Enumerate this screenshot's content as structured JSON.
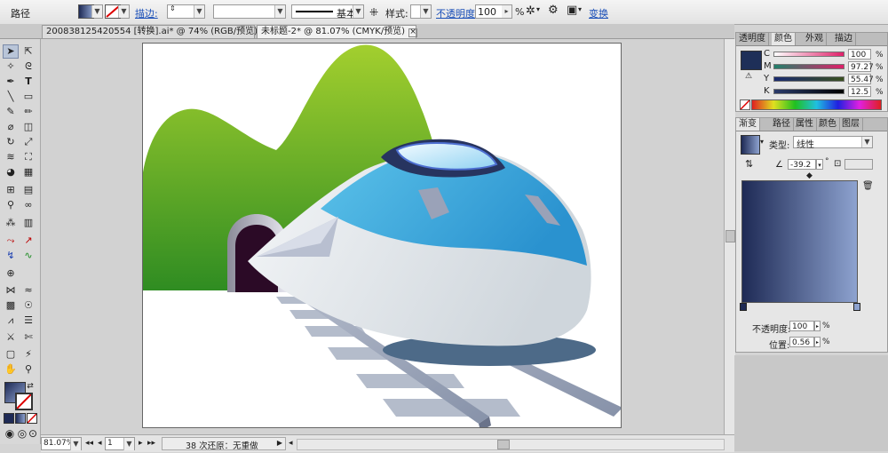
{
  "control_bar": {
    "object_type": "路径",
    "stroke_link": "描边:",
    "stroke_weight": "",
    "brush_value": "",
    "stroke_profile": "基本",
    "style_label": "样式:",
    "opacity_link": "不透明度:",
    "opacity_value": "100",
    "opacity_unit": "%",
    "transform_link": "变换"
  },
  "tabs": [
    {
      "label": "200838125420554  [转换].ai* @ 74% (RGB/预览)",
      "active": false
    },
    {
      "label": "未标题-2* @ 81.07% (CMYK/预览)",
      "active": true
    }
  ],
  "color_panel": {
    "tabs": [
      "透明度",
      "颜色",
      "外观",
      "描边"
    ],
    "active_tab": "颜色",
    "channels": [
      {
        "name": "C",
        "value": "100",
        "color": "#e0206a"
      },
      {
        "name": "M",
        "value": "97.27",
        "color": "#2aa070"
      },
      {
        "name": "Y",
        "value": "55.47",
        "color": "#c8c000"
      },
      {
        "name": "K",
        "value": "12.5",
        "color": "#222222"
      }
    ],
    "fill_color": "#1e2f58"
  },
  "gradient_panel": {
    "tabs": [
      "渐变",
      "路径",
      "属性",
      "颜色",
      "图层"
    ],
    "active_tab": "渐变",
    "type_label": "类型:",
    "type_value": "线性",
    "angle_value": "-39.2",
    "angle_unit": "°",
    "opacity_label": "不透明度:",
    "opacity_value": "100",
    "position_label": "位置:",
    "position_value": "0.56",
    "unit": "%",
    "start_color": "#1e2a55",
    "end_color": "#8da2cf"
  },
  "status_bar": {
    "zoom": "81.07%",
    "artboard_number": "1",
    "history": "38 次还原：无重做"
  }
}
